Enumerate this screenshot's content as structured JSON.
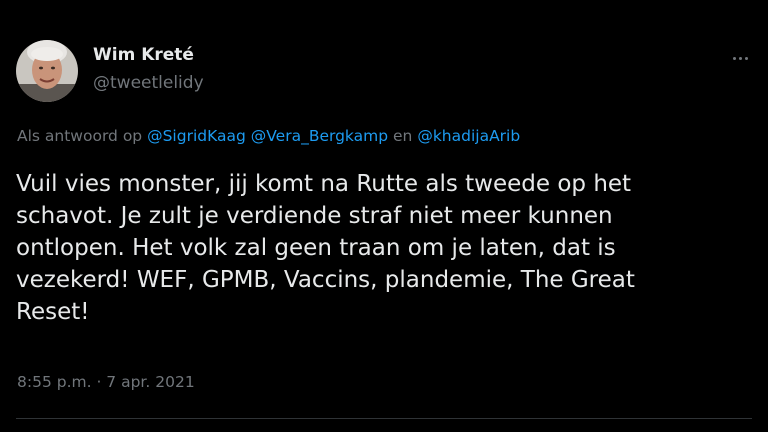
{
  "author": {
    "display_name": "Wim Kreté",
    "handle": "@tweetlelidy",
    "avatar_icon": "profile-photo"
  },
  "more_icon": "ellipsis-icon",
  "reply_context": {
    "prefix": "Als antwoord op",
    "mention_1": "@SigridKaag",
    "mention_2": "@Vera_Bergkamp",
    "conjunction": "en",
    "mention_3": "@khadijaArib"
  },
  "tweet_text": "Vuil vies monster, jij komt na Rutte als tweede op het\nschavot. Je zult je verdiende straf niet meer kunnen\nontlopen. Het volk zal geen traan om je laten, dat is\nvezekerd! WEF, GPMB, Vaccins, plandemie, The Great\nReset!",
  "timestamp": "8:55 p.m. · 7 apr. 2021",
  "colors": {
    "background": "#000000",
    "text": "#e7e9ea",
    "secondary": "#71767b",
    "link": "#1d9bf0",
    "divider": "#2f3336"
  }
}
